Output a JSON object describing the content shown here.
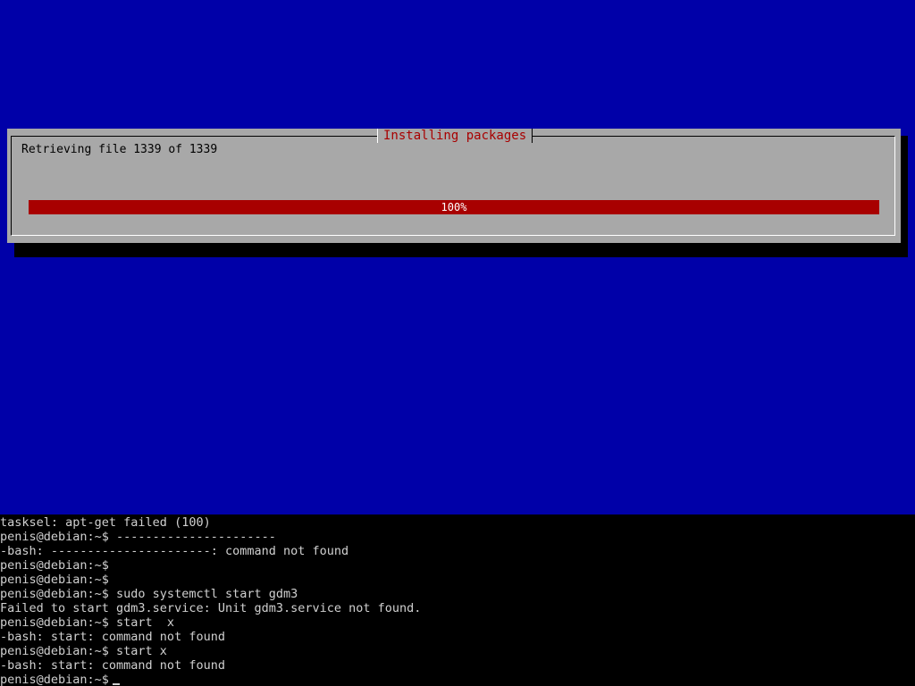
{
  "installer": {
    "dialog_title": "Installing packages",
    "status_text": "Retrieving file 1339 of 1339",
    "progress": {
      "percent": 100,
      "label": "100%"
    },
    "colors": {
      "background": "#0000a8",
      "dialog": "#a8a8a8",
      "title_text": "#a80000",
      "progress_bar": "#a80000",
      "shadow": "#000000"
    }
  },
  "terminal": {
    "lines": [
      "tasksel: apt-get failed (100)",
      "penis@debian:~$ ----------------------",
      "-bash: ----------------------: command not found",
      "penis@debian:~$",
      "penis@debian:~$",
      "penis@debian:~$ sudo systemctl start gdm3",
      "Failed to start gdm3.service: Unit gdm3.service not found.",
      "penis@debian:~$ start  x",
      "-bash: start: command not found",
      "penis@debian:~$ start x",
      "-bash: start: command not found"
    ],
    "prompt": "penis@debian:~$",
    "colors": {
      "background": "#000000",
      "text": "#d0d0d0"
    }
  }
}
